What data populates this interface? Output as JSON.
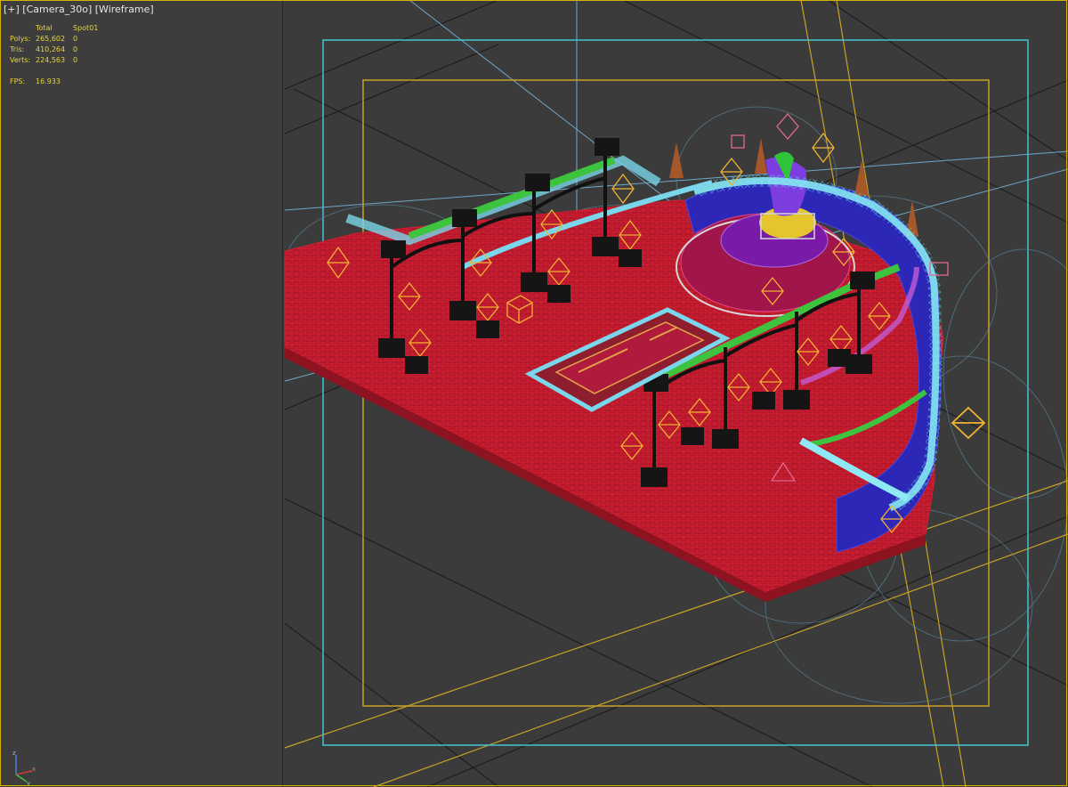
{
  "viewport": {
    "label": "[+] [Camera_30o] [Wireframe]",
    "mode": "Wireframe"
  },
  "stats": {
    "headers": [
      "Total",
      "Spot01"
    ],
    "rows": [
      {
        "label": "Polys:",
        "total": "265,602",
        "spot": "0"
      },
      {
        "label": "Tris:",
        "total": "410,264",
        "spot": "0"
      },
      {
        "label": "Verts:",
        "total": "224,563",
        "spot": "0"
      }
    ],
    "fps_label": "FPS:",
    "fps_value": "16.933"
  },
  "colors": {
    "background": "#3b3b3b",
    "active_border": "#d4b200",
    "safe_frame_outer": "#43c4cf",
    "safe_frame_inner": "#c9a227",
    "floor": "#c41a2e",
    "stats_text": "#e8d43e"
  },
  "icons": [
    "axis-tripod-icon",
    "spotlight-icon"
  ]
}
